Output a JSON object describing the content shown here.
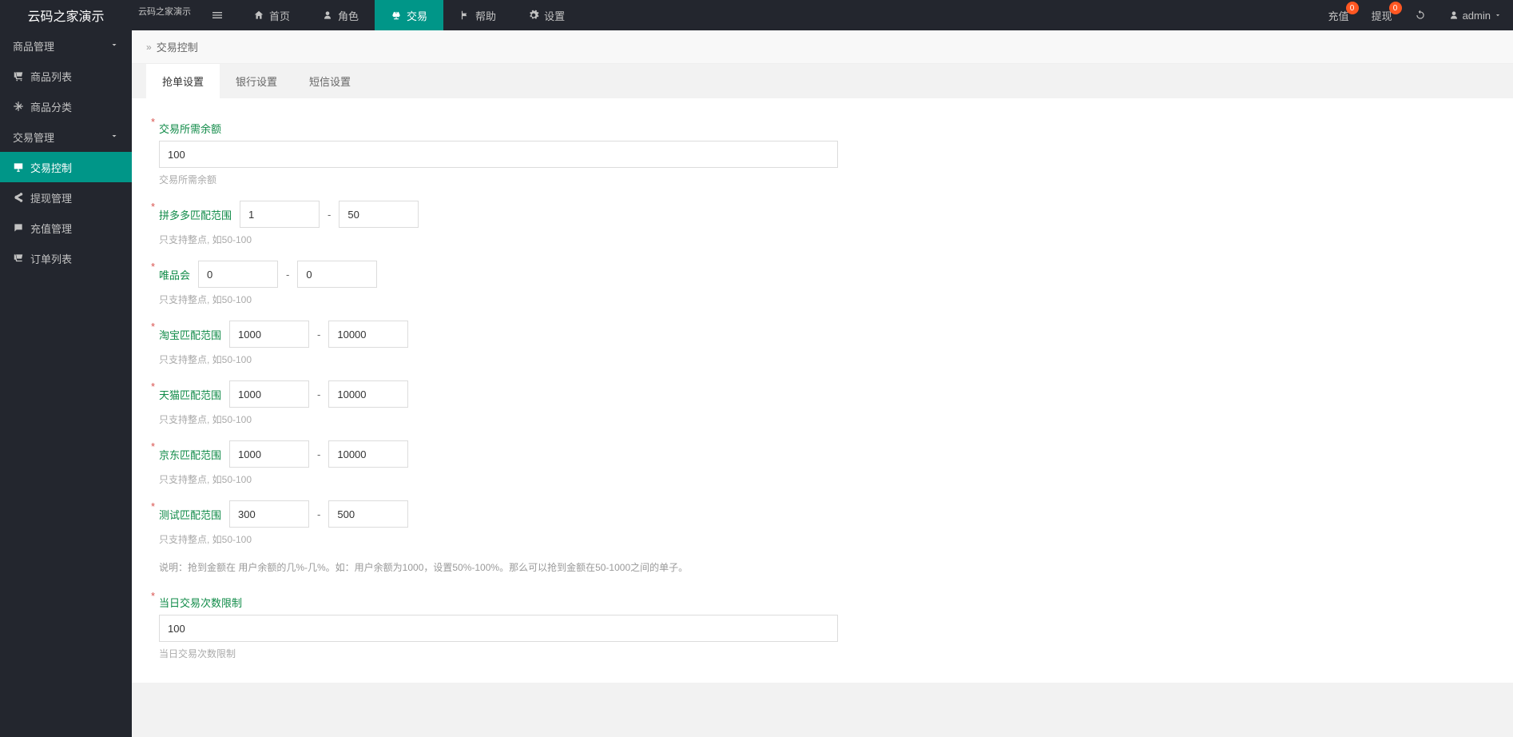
{
  "brand": {
    "title": "云码之家演示",
    "subtitle": "云码之家演示"
  },
  "nav": {
    "home": "首页",
    "role": "角色",
    "trade": "交易",
    "help": "帮助",
    "settings": "设置"
  },
  "headerRight": {
    "recharge": "充值",
    "rechargeBadge": "0",
    "withdraw": "提现",
    "withdrawBadge": "0",
    "user": "admin"
  },
  "sidebar": {
    "productMgmt": "商品管理",
    "productList": "商品列表",
    "productCat": "商品分类",
    "tradeMgmt": "交易管理",
    "tradeCtrl": "交易控制",
    "withdrawMgmt": "提现管理",
    "rechargeMgmt": "充值管理",
    "orderList": "订单列表"
  },
  "breadcrumb": {
    "title": "交易控制"
  },
  "tabs": {
    "grab": "抢单设置",
    "bank": "银行设置",
    "sms": "短信设置"
  },
  "form": {
    "balance": {
      "label": "交易所需余额",
      "value": "100",
      "hint": "交易所需余额"
    },
    "pdd": {
      "label": "拼多多匹配范围",
      "min": "1",
      "max": "50",
      "hint": "只支持整点, 如50-100"
    },
    "wph": {
      "label": "唯品会",
      "min": "0",
      "max": "0",
      "hint": "只支持整点, 如50-100"
    },
    "taobao": {
      "label": "淘宝匹配范围",
      "min": "1000",
      "max": "10000",
      "hint": "只支持整点, 如50-100"
    },
    "tmall": {
      "label": "天猫匹配范围",
      "min": "1000",
      "max": "10000",
      "hint": "只支持整点, 如50-100"
    },
    "jd": {
      "label": "京东匹配范围",
      "min": "1000",
      "max": "10000",
      "hint": "只支持整点, 如50-100"
    },
    "test": {
      "label": "测试匹配范围",
      "min": "300",
      "max": "500",
      "hint": "只支持整点, 如50-100"
    },
    "explain": "说明：抢到金额在 用户余额的几%-几%。如：用户余额为1000，设置50%-100%。那么可以抢到金额在50-1000之间的单子。",
    "dailyLimit": {
      "label": "当日交易次数限制",
      "value": "100",
      "hint": "当日交易次数限制"
    }
  }
}
